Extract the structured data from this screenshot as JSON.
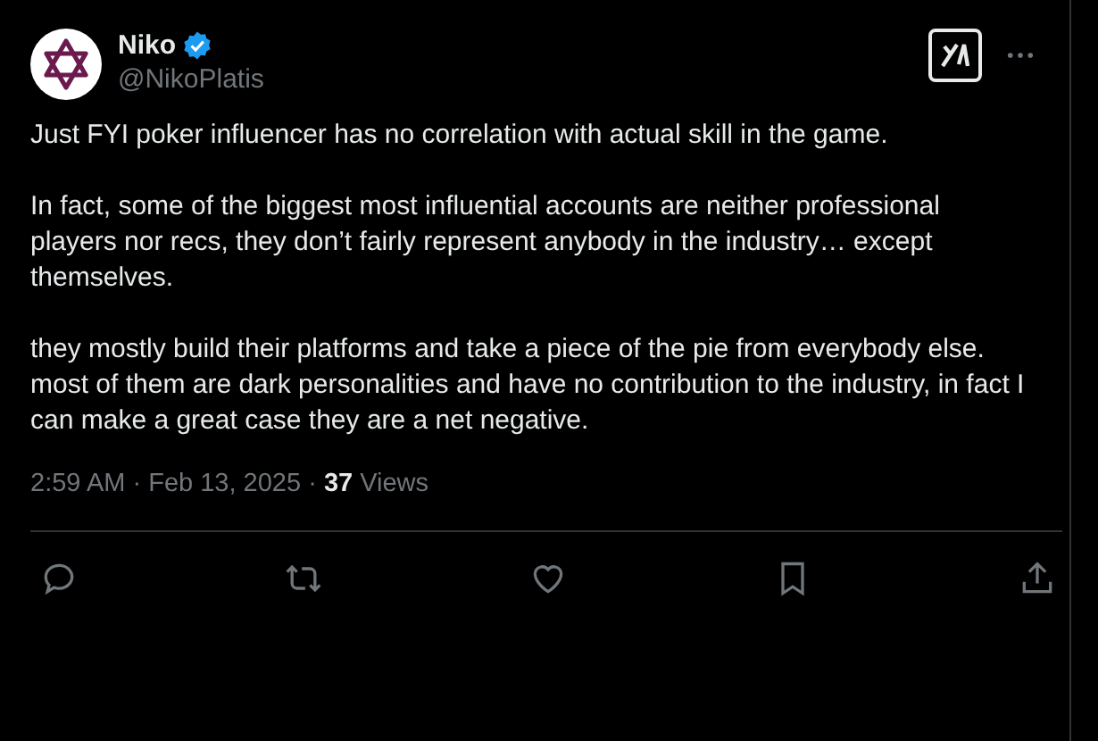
{
  "author": {
    "name": "Niko",
    "handle": "@NikoPlatis",
    "verified": true
  },
  "paragraphs": [
    "Just FYI poker influencer has no correlation with actual skill in the game.",
    "In fact, some of the biggest most influential accounts are neither professional players nor recs, they don’t fairly represent anybody in the industry… except themselves.",
    "they mostly build their platforms and take a piece of the pie from everybody else. most of them are dark personalities and have no contribution to the industry, in fact I can make a great case they are a net negative."
  ],
  "meta": "2:59 AM · Feb 13, 2025 · **37** Views"
}
